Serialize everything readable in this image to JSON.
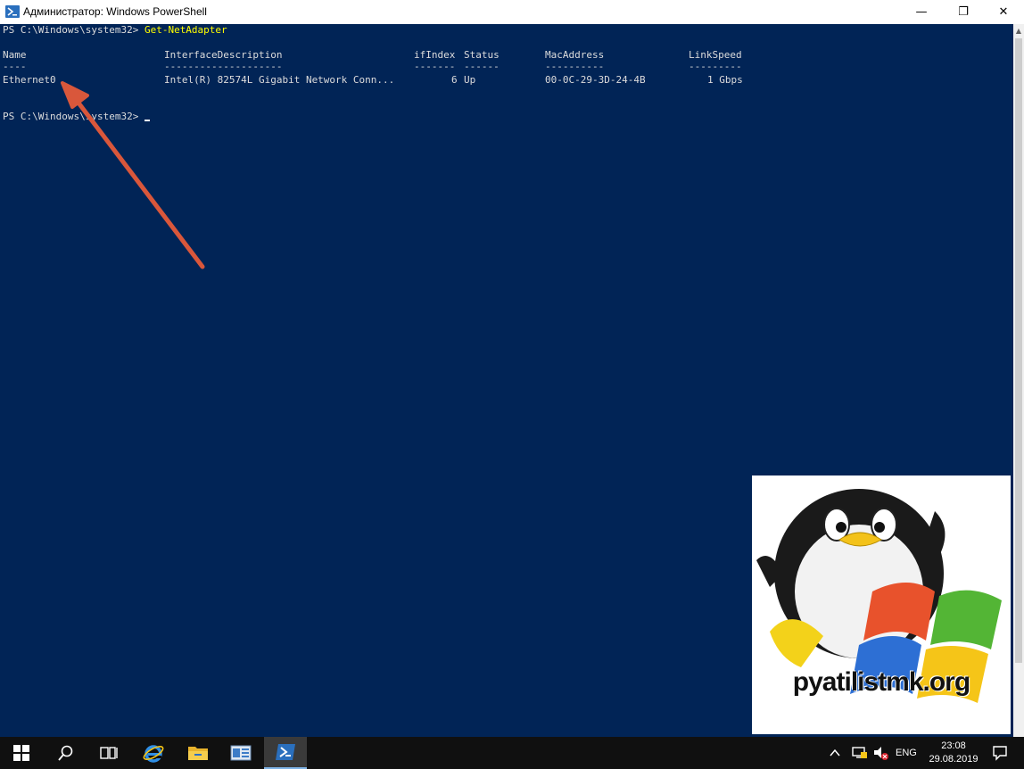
{
  "window": {
    "title": "Администратор: Windows PowerShell",
    "minimize": "—",
    "maximize": "❐",
    "close": "✕"
  },
  "console": {
    "prompt": "PS C:\\Windows\\system32> ",
    "command": "Get-NetAdapter",
    "headers": [
      "Name",
      "InterfaceDescription",
      "ifIndex",
      "Status",
      "MacAddress",
      "LinkSpeed"
    ],
    "separators": [
      "----",
      "--------------------",
      "-------",
      "------",
      "----------",
      "---------"
    ],
    "rows": [
      [
        "Ethernet0",
        "Intel(R) 82574L Gigabit Network Conn...",
        "6",
        "Up",
        "00-0C-29-3D-24-4B",
        "1 Gbps"
      ]
    ],
    "prompt2": "PS C:\\Windows\\system32> "
  },
  "annotation": {
    "arrow_color": "#d9573b",
    "icon": "red-arrow-icon"
  },
  "logo": {
    "text": "pyatilistmk.org"
  },
  "taskbar": {
    "icons": [
      "windows-start-icon",
      "search-icon",
      "task-view-icon",
      "internet-explorer-icon",
      "file-explorer-icon",
      "server-manager-icon",
      "powershell-icon"
    ],
    "tray_lang": "ENG",
    "time": "23:08",
    "date": "29.08.2019"
  },
  "colors": {
    "console_bg": "#012456",
    "command": "#ffff00",
    "text": "#dcdcdc"
  }
}
